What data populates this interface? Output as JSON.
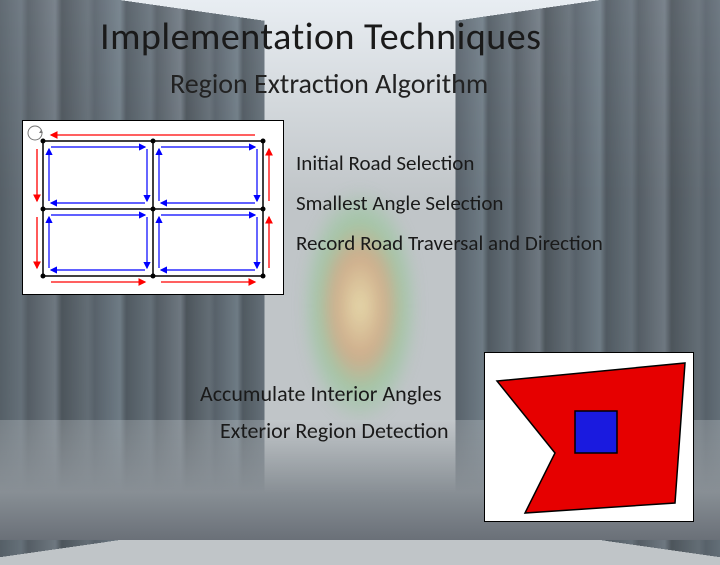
{
  "title": "Implementation Techniques",
  "subtitle": "Region Extraction Algorithm",
  "bullets": [
    "Initial Road Selection",
    "Smallest Angle Selection",
    "Record Road Traversal and Direction"
  ],
  "lower": {
    "line1": "Accumulate Interior Angles",
    "line2": "Exterior Region Detection"
  },
  "colors": {
    "red": "#ff0000",
    "blue": "#0000ff",
    "black": "#000000"
  }
}
